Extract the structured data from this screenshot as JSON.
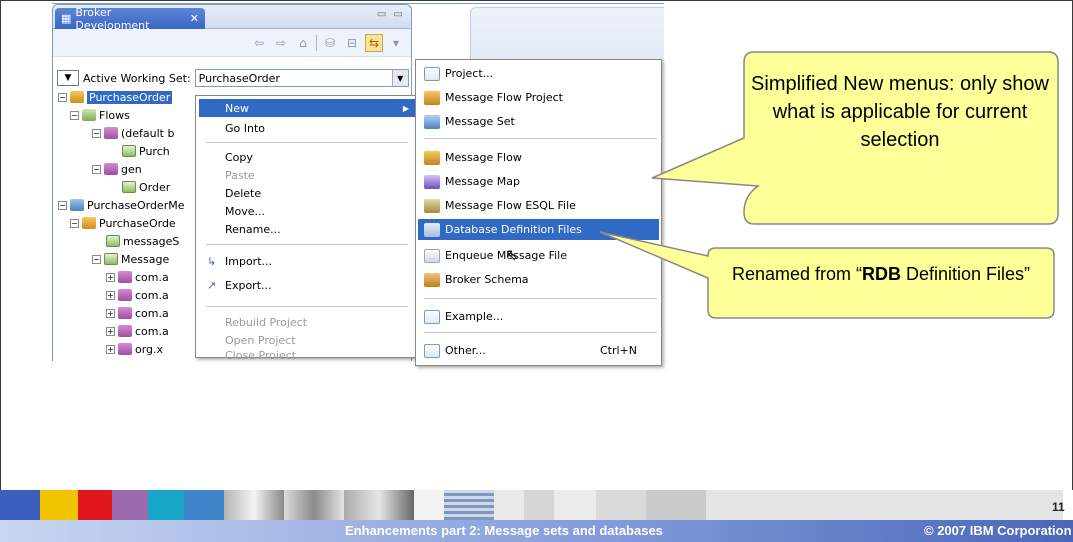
{
  "view": {
    "tab_label": "Broker Development",
    "close_glyph": "✕",
    "minmax_glyph": "▭ ▭",
    "working_set_label": "Active Working Set:",
    "working_set_value": "PurchaseOrder"
  },
  "tree": {
    "items": [
      {
        "label": "PurchaseOrder"
      },
      {
        "label": "Flows"
      },
      {
        "label": "(default b"
      },
      {
        "label": "Purch"
      },
      {
        "label": "gen"
      },
      {
        "label": "Order"
      },
      {
        "label": "PurchaseOrderMe"
      },
      {
        "label": "PurchaseOrde"
      },
      {
        "label": "messageS"
      },
      {
        "label": "Message"
      },
      {
        "label": "com.a"
      },
      {
        "label": "com.a"
      },
      {
        "label": "com.a"
      },
      {
        "label": "com.a"
      },
      {
        "label": "org.x"
      }
    ]
  },
  "context_menu": {
    "new": "New",
    "go_into": "Go Into",
    "copy": "Copy",
    "paste": "Paste",
    "delete": "Delete",
    "move": "Move...",
    "rename": "Rename...",
    "import": "Import...",
    "export": "Export...",
    "rebuild": "Rebuild Project",
    "open": "Open Project",
    "close": "Close Project"
  },
  "submenu": {
    "project": "Project...",
    "flow_project": "Message Flow Project",
    "message_set": "Message Set",
    "message_flow": "Message Flow",
    "message_map": "Message Map",
    "esql_file": "Message Flow ESQL File",
    "db_definition": "Database Definition Files",
    "enqueue": "Enqueue Message File",
    "broker_schema": "Broker Schema",
    "example": "Example...",
    "other": "Other...",
    "other_shortcut": "Ctrl+N"
  },
  "callouts": {
    "simplified": "Simplified New menus: only show what is applicable for current selection",
    "renamed_prefix": "Renamed from “",
    "renamed_bold": "RDB",
    "renamed_suffix": " Definition Files”"
  },
  "footer": {
    "title": "Enhancements part 2: Message sets and databases",
    "copyright": "© 2007 IBM Corporation",
    "page": "11"
  },
  "colors": {
    "selection": "#316ac5",
    "callout_fill": "#ffff99",
    "footer_bar": "#7e97d8"
  }
}
